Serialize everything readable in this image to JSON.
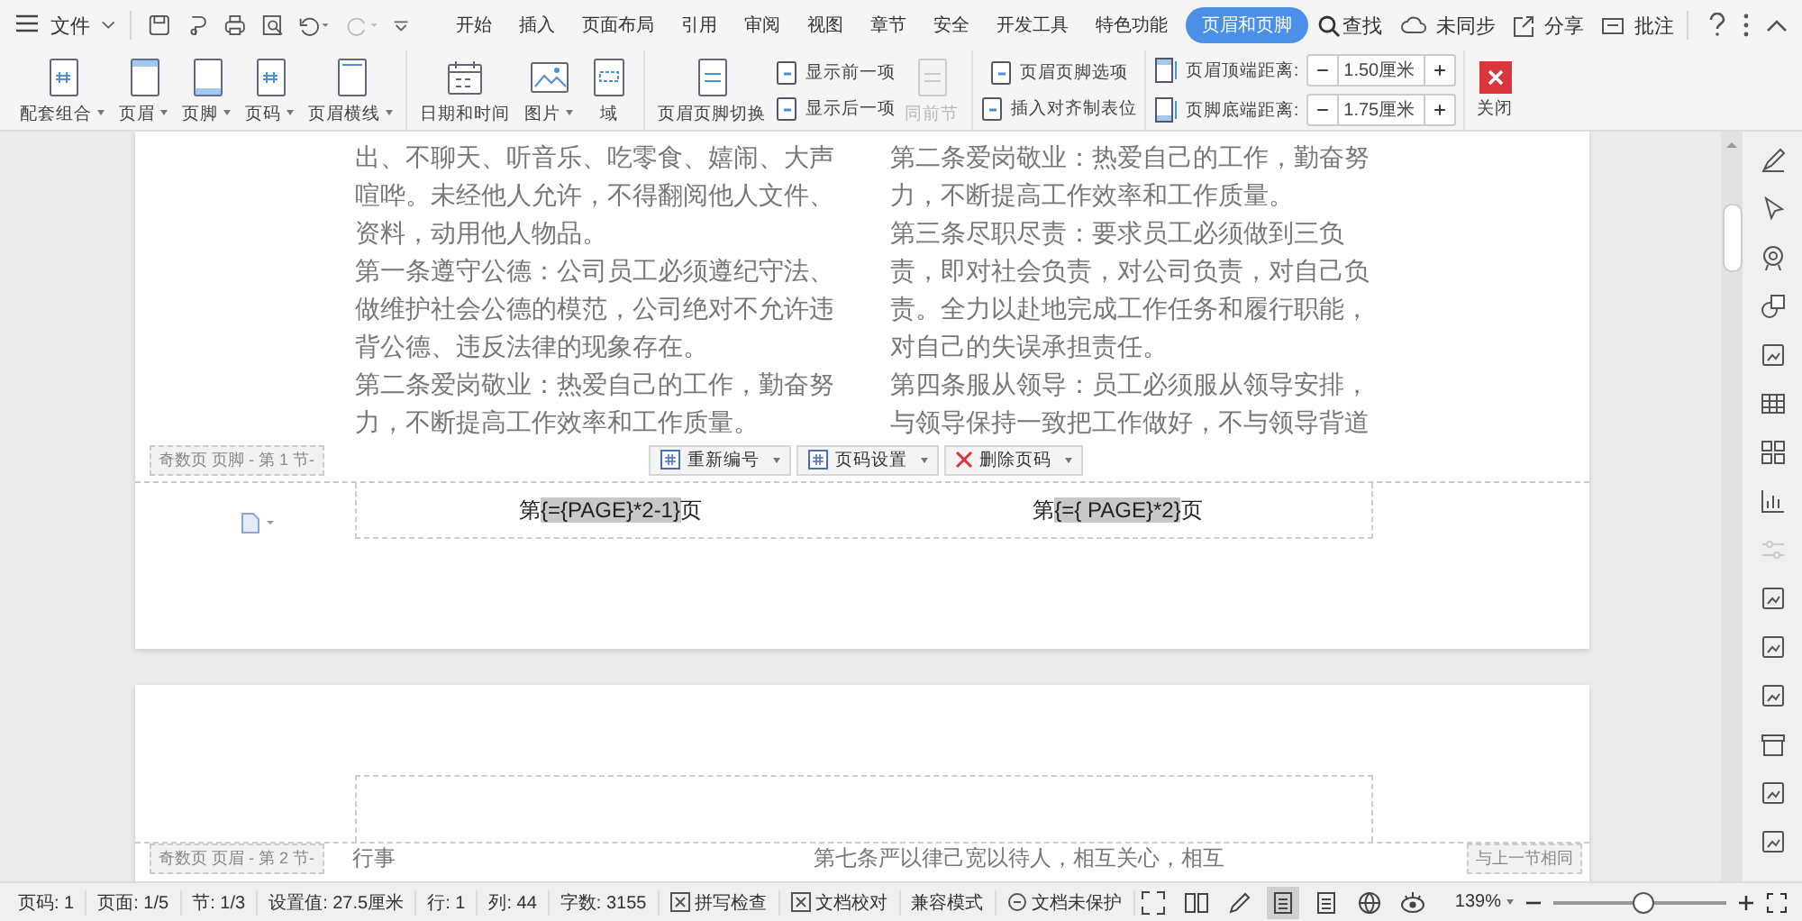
{
  "menu_bar": {
    "file_label": "文件",
    "tabs": [
      {
        "label": "开始",
        "selected": false
      },
      {
        "label": "插入",
        "selected": false
      },
      {
        "label": "页面布局",
        "selected": false
      },
      {
        "label": "引用",
        "selected": false
      },
      {
        "label": "审阅",
        "selected": false
      },
      {
        "label": "视图",
        "selected": false
      },
      {
        "label": "章节",
        "selected": false
      },
      {
        "label": "安全",
        "selected": false
      },
      {
        "label": "开发工具",
        "selected": false
      },
      {
        "label": "特色功能",
        "selected": false
      },
      {
        "label": "页眉和页脚",
        "selected": true
      }
    ],
    "search_label": "查找",
    "sync_label": "未同步",
    "share_label": "分享",
    "comment_label": "批注"
  },
  "ribbon": {
    "groups": [
      [
        {
          "label": "配套组合",
          "kind": "big",
          "dropdown": true,
          "disabled": false
        },
        {
          "label": "页眉",
          "kind": "big",
          "dropdown": true,
          "disabled": false
        },
        {
          "label": "页脚",
          "kind": "big",
          "dropdown": true,
          "disabled": false
        },
        {
          "label": "页码",
          "kind": "big",
          "dropdown": true,
          "disabled": false
        },
        {
          "label": "页眉横线",
          "kind": "big",
          "dropdown": true,
          "disabled": false
        }
      ],
      [
        {
          "label": "日期和时间",
          "kind": "big",
          "dropdown": false,
          "disabled": false
        },
        {
          "label": "图片",
          "kind": "big",
          "dropdown": true,
          "disabled": false
        },
        {
          "label": "域",
          "kind": "big",
          "dropdown": false,
          "disabled": false
        }
      ],
      [
        {
          "label": "页眉页脚切换",
          "kind": "big",
          "dropdown": false,
          "disabled": false
        },
        {
          "label": "显示前一项",
          "kind": "small",
          "dropdown": false,
          "disabled": false
        },
        {
          "label": "显示后一项",
          "kind": "small",
          "dropdown": false,
          "disabled": false
        },
        {
          "label": "同前节",
          "kind": "big",
          "dropdown": false,
          "disabled": true
        }
      ],
      [
        {
          "label": "页眉页脚选项",
          "kind": "small",
          "dropdown": false,
          "disabled": false
        },
        {
          "label": "插入对齐制表位",
          "kind": "small",
          "dropdown": false,
          "disabled": false
        }
      ]
    ],
    "spinners": [
      {
        "label": "页眉顶端距离:",
        "value": "1.50厘米"
      },
      {
        "label": "页脚底端距离:",
        "value": "1.75厘米"
      }
    ],
    "close_label": "关闭"
  },
  "page_1": {
    "left_column": [
      "出、不聊天、听音乐、吃零食、嬉闹、大声喧哗。未经他人允许，不得翻阅他人文件、资料，动用他人物品。",
      "第一条遵守公德：公司员工必须遵纪守法、做维护社会公德的模范，公司绝对不允许违背公德、违反法律的现象存在。",
      "第二条爱岗敬业：热爱自己的工作，勤奋努力，不断提高工作效率和工作质量。"
    ],
    "right_column": [
      "第二条爱岗敬业：热爱自己的工作，勤奋努力，不断提高工作效率和工作质量。",
      "第三条尽职尽责：要求员工必须做到三负责，即对社会负责，对公司负责，对自己负责。全力以赴地完成工作任务和履行职能，对自己的失误承担责任。",
      "第四条服从领导：员工必须服从领导安排，与领导保持一致把工作做好，不与领导背道"
    ],
    "footer_label": "奇数页 页脚 - 第 1 节-",
    "footer_tools": [
      "重新编号",
      "页码设置",
      "删除页码"
    ],
    "page_numbers": [
      {
        "prefix": "第",
        "field": "{={PAGE}*2-1}",
        "suffix": "页"
      },
      {
        "prefix": "第",
        "field": "{={  PAGE}*2}",
        "suffix": "页"
      }
    ]
  },
  "page_2": {
    "header_label": "奇数页 页眉 - 第 2 节-",
    "same_as_previous_label": "与上一节相同",
    "left_text": "行事",
    "right_text": "第七条严以律己宽以待人，相互关心，相互"
  },
  "status_bar": {
    "items": [
      {
        "label": "页码: 1",
        "kind": "text"
      },
      {
        "label": "页面: 1/5",
        "kind": "text"
      },
      {
        "label": "节: 1/3",
        "kind": "text"
      },
      {
        "label": "设置值: 27.5厘米",
        "kind": "text"
      },
      {
        "label": "行: 1",
        "kind": "text"
      },
      {
        "label": "列: 44",
        "kind": "text"
      },
      {
        "label": "字数: 3155",
        "kind": "text"
      },
      {
        "label": "拼写检查",
        "kind": "toggle"
      },
      {
        "label": "文档校对",
        "kind": "toggle"
      },
      {
        "label": "兼容模式",
        "kind": "text"
      },
      {
        "label": "文档未保护",
        "kind": "lock"
      }
    ],
    "view_modes": [
      {
        "selected": false
      },
      {
        "selected": false
      },
      {
        "selected": false
      },
      {
        "selected": true
      },
      {
        "selected": false
      },
      {
        "selected": false
      },
      {
        "selected": false
      }
    ],
    "zoom": "139%",
    "zoom_slider": {
      "level": 0.52
    }
  }
}
